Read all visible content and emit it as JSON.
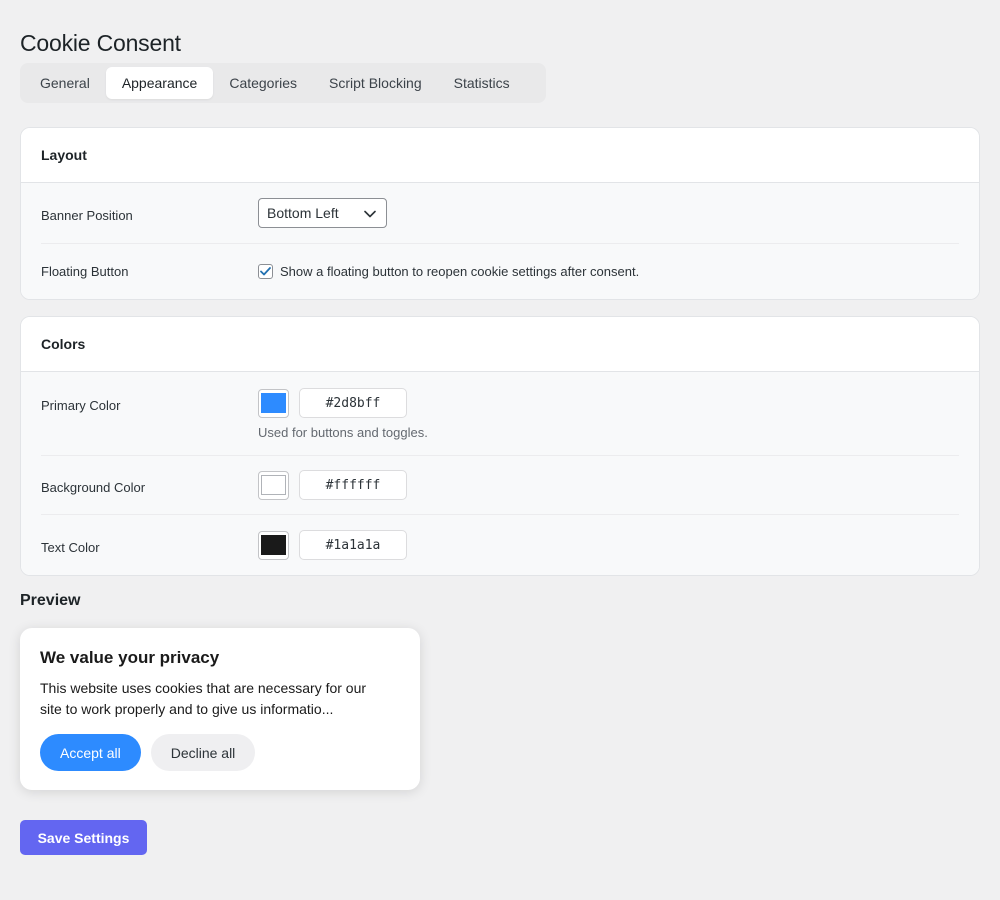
{
  "page": {
    "title": "Cookie Consent"
  },
  "tabs": [
    {
      "label": "General",
      "active": false
    },
    {
      "label": "Appearance",
      "active": true
    },
    {
      "label": "Categories",
      "active": false
    },
    {
      "label": "Script Blocking",
      "active": false
    },
    {
      "label": "Statistics",
      "active": false
    }
  ],
  "layout": {
    "heading": "Layout",
    "banner_position": {
      "label": "Banner Position",
      "value": "Bottom Left"
    },
    "floating_button": {
      "label": "Floating Button",
      "checked": true,
      "description": "Show a floating button to reopen cookie settings after consent."
    }
  },
  "colors": {
    "heading": "Colors",
    "primary": {
      "label": "Primary Color",
      "value": "#2d8bff",
      "help": "Used for buttons and toggles."
    },
    "background": {
      "label": "Background Color",
      "value": "#ffffff"
    },
    "text": {
      "label": "Text Color",
      "value": "#1a1a1a"
    }
  },
  "preview": {
    "heading": "Preview",
    "banner_title": "We value your privacy",
    "banner_text": "This website uses cookies that are necessary for our site to work properly and to give us informatio...",
    "accept_label": "Accept all",
    "decline_label": "Decline all"
  },
  "actions": {
    "save_label": "Save Settings"
  },
  "theme": {
    "accent": "#6366f1",
    "checkbox_color": "#2271b1"
  },
  "icons": {
    "select_arrow": "chevron-down-icon",
    "checkbox": "checkmark-icon"
  }
}
